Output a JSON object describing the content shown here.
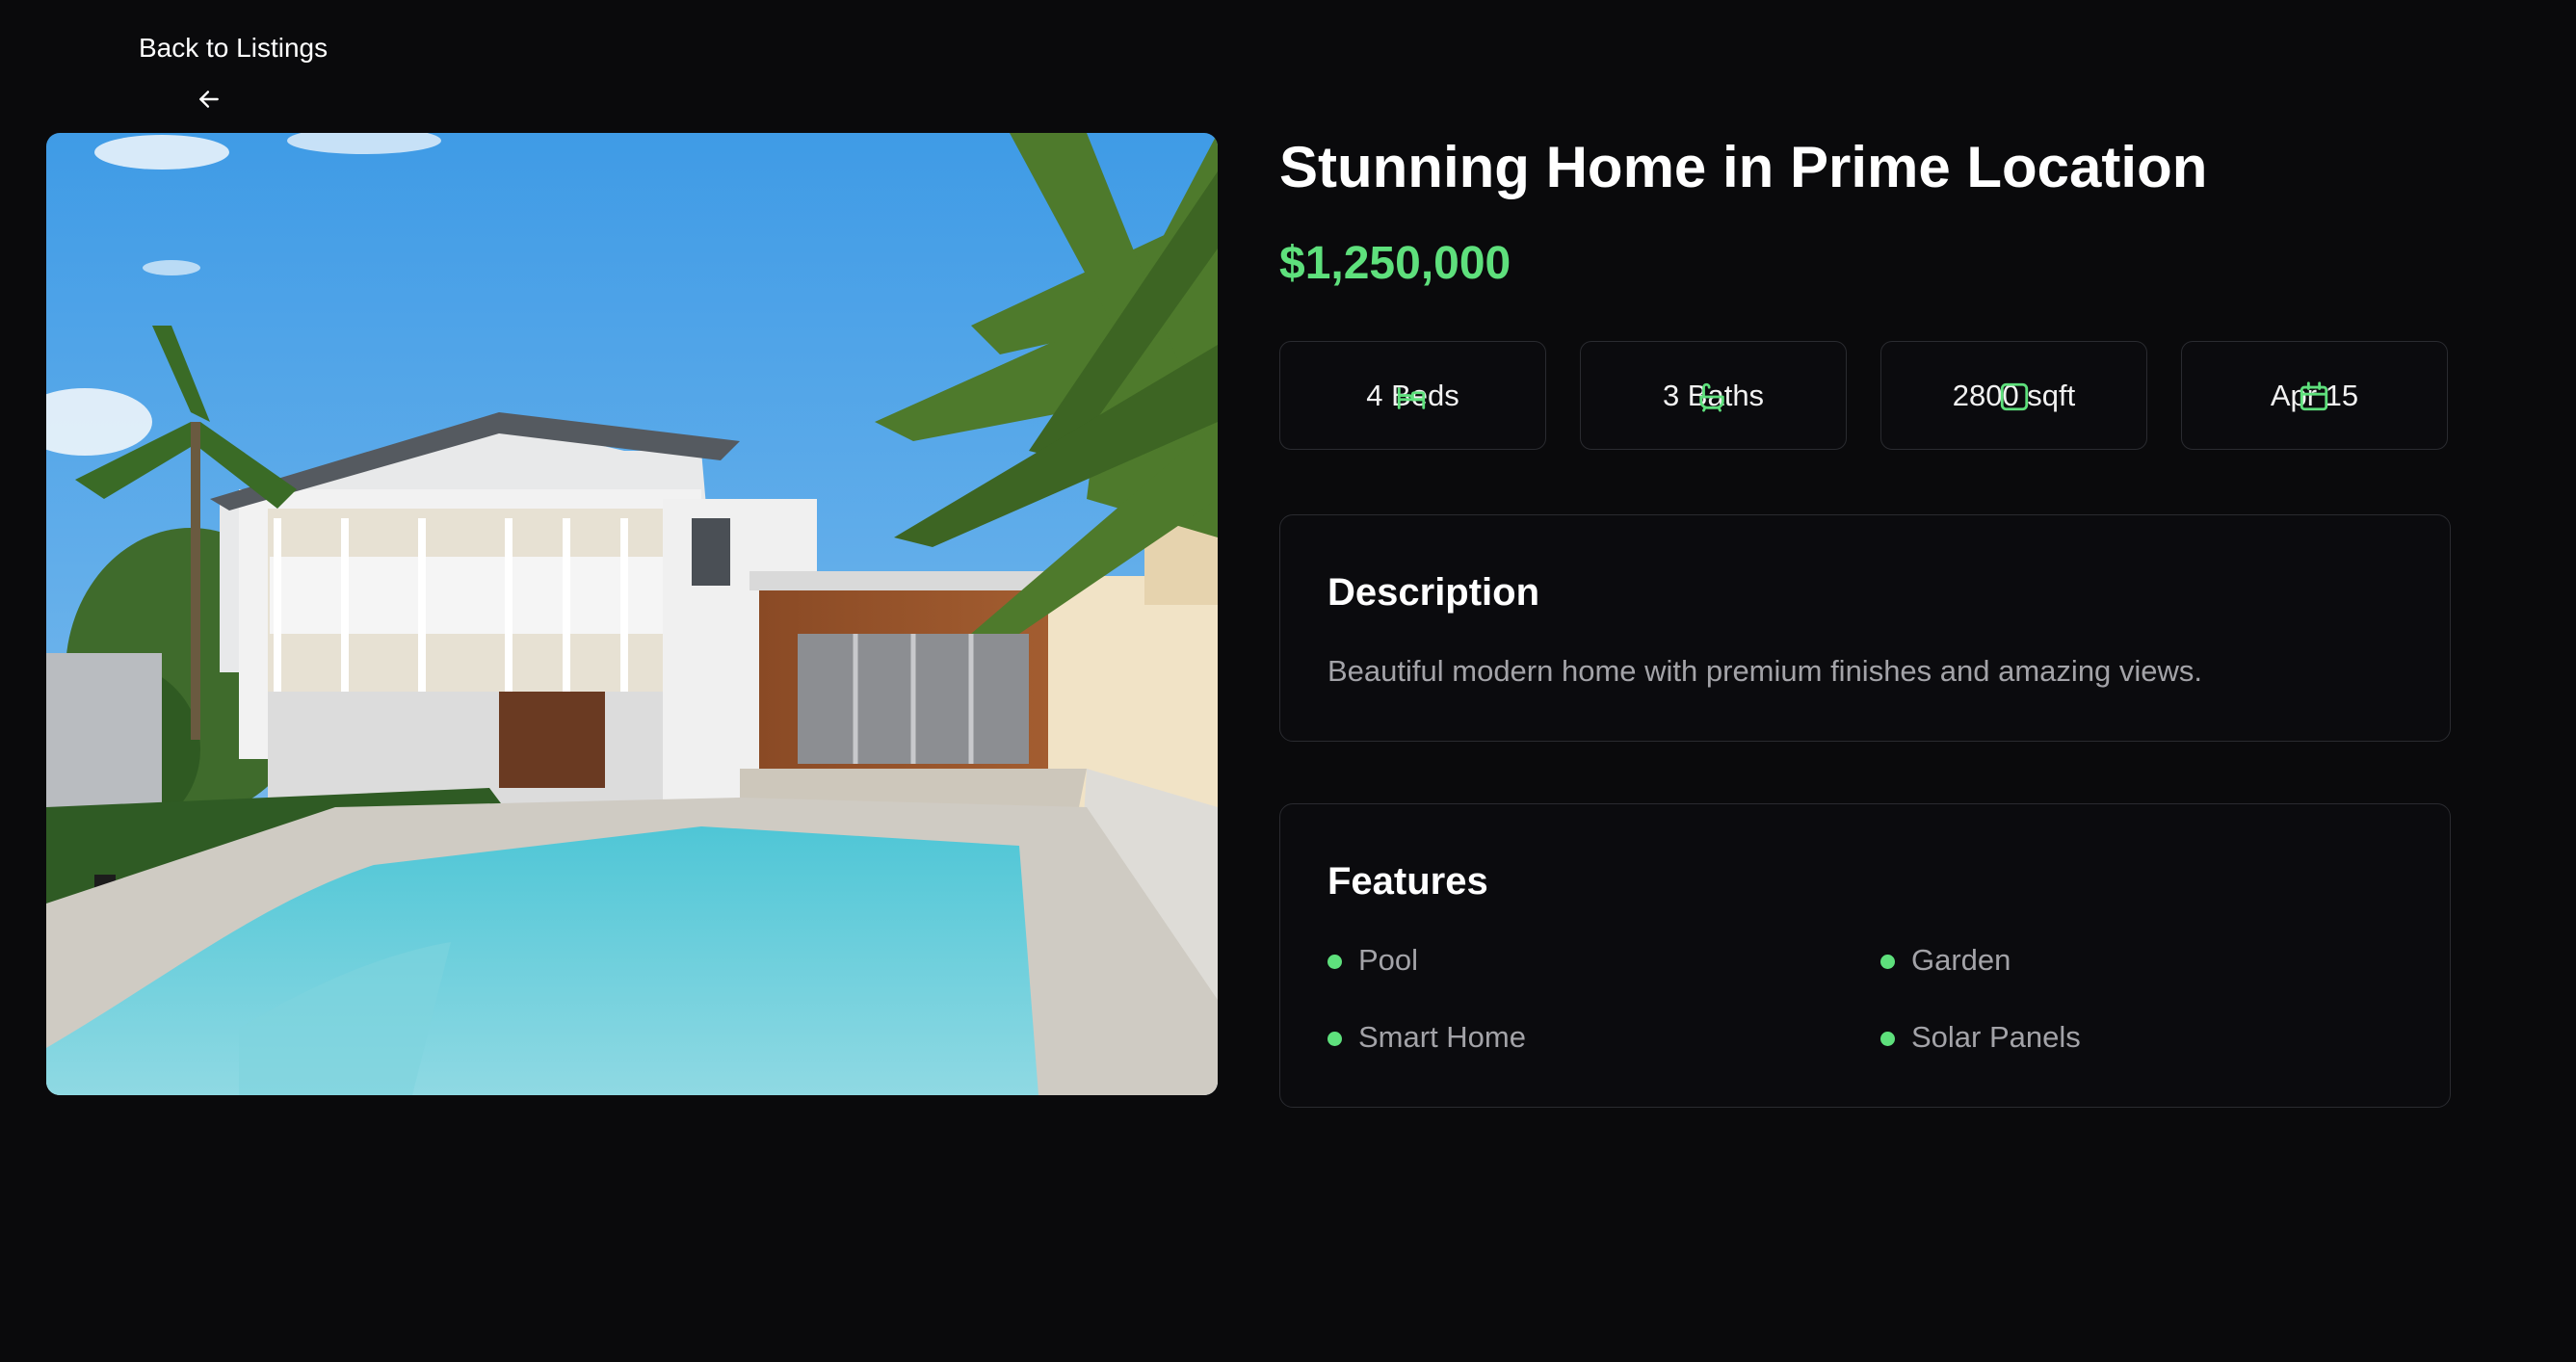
{
  "nav": {
    "back_label": "Back to Listings",
    "back_icon": "arrow-left-icon"
  },
  "listing": {
    "title": "Stunning Home in Prime Location",
    "price": "$1,250,000",
    "photo_icon": "house-photo",
    "stats": [
      {
        "label": "4 Beds",
        "icon": "bed-icon"
      },
      {
        "label": "3 Baths",
        "icon": "bath-icon"
      },
      {
        "label": "2800 sqft",
        "icon": "area-icon"
      },
      {
        "label": "Apr 15",
        "icon": "calendar-icon"
      }
    ],
    "description": {
      "heading": "Description",
      "text": "Beautiful modern home with premium finishes and amazing views."
    },
    "features": {
      "heading": "Features",
      "items": [
        "Pool",
        "Garden",
        "Smart Home",
        "Solar Panels"
      ]
    }
  },
  "colors": {
    "background": "#0a0a0c",
    "accent": "#5ee07c",
    "card_border": "#2a2b30",
    "muted_text": "#a3a3a8"
  }
}
